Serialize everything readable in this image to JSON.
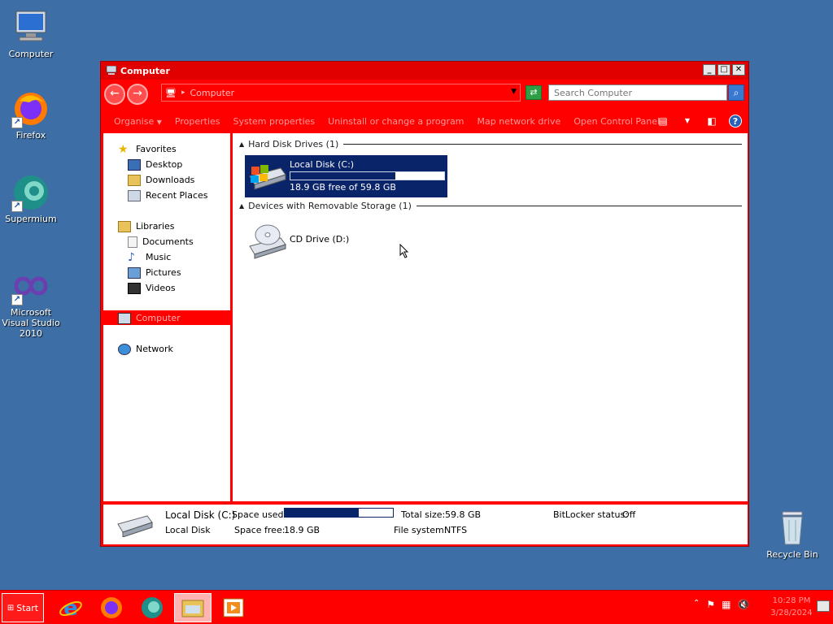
{
  "desktop": {
    "icons": [
      {
        "label": "Computer"
      },
      {
        "label": "Firefox"
      },
      {
        "label": "Supermium"
      },
      {
        "label": "Microsoft Visual Studio 2010"
      },
      {
        "label": "Recycle Bin"
      }
    ]
  },
  "window": {
    "title": "Computer",
    "address": "Computer",
    "search_placeholder": "Search Computer",
    "toolbar": {
      "organise": "Organise",
      "properties": "Properties",
      "system_properties": "System properties",
      "uninstall": "Uninstall or change a program",
      "map_drive": "Map network drive",
      "control_panel": "Open Control Panel"
    }
  },
  "navpane": {
    "favorites": "Favorites",
    "desktop": "Desktop",
    "downloads": "Downloads",
    "recent_places": "Recent Places",
    "libraries": "Libraries",
    "documents": "Documents",
    "music": "Music",
    "pictures": "Pictures",
    "videos": "Videos",
    "computer": "Computer",
    "network": "Network"
  },
  "content": {
    "hdd_group": "Hard Disk Drives (1)",
    "removable_group": "Devices with Removable Storage (1)",
    "local_disk": {
      "name": "Local Disk (C:)",
      "free_text": "18.9 GB free of 59.8 GB",
      "used_fraction": 0.684
    },
    "cd_drive": {
      "name": "CD Drive (D:)"
    }
  },
  "details": {
    "name": "Local Disk (C:)",
    "type": "Local Disk",
    "space_used_label": "Space used:",
    "space_free_label": "Space free:",
    "space_free": "18.9 GB",
    "total_size_label": "Total size:",
    "total_size": "59.8 GB",
    "filesystem_label": "File system:",
    "filesystem": "NTFS",
    "bitlocker_label": "BitLocker status:",
    "bitlocker": "Off",
    "used_fraction": 0.684
  },
  "taskbar": {
    "start": "Start",
    "clock_time": "10:28 PM",
    "clock_date": "3/28/2024"
  }
}
